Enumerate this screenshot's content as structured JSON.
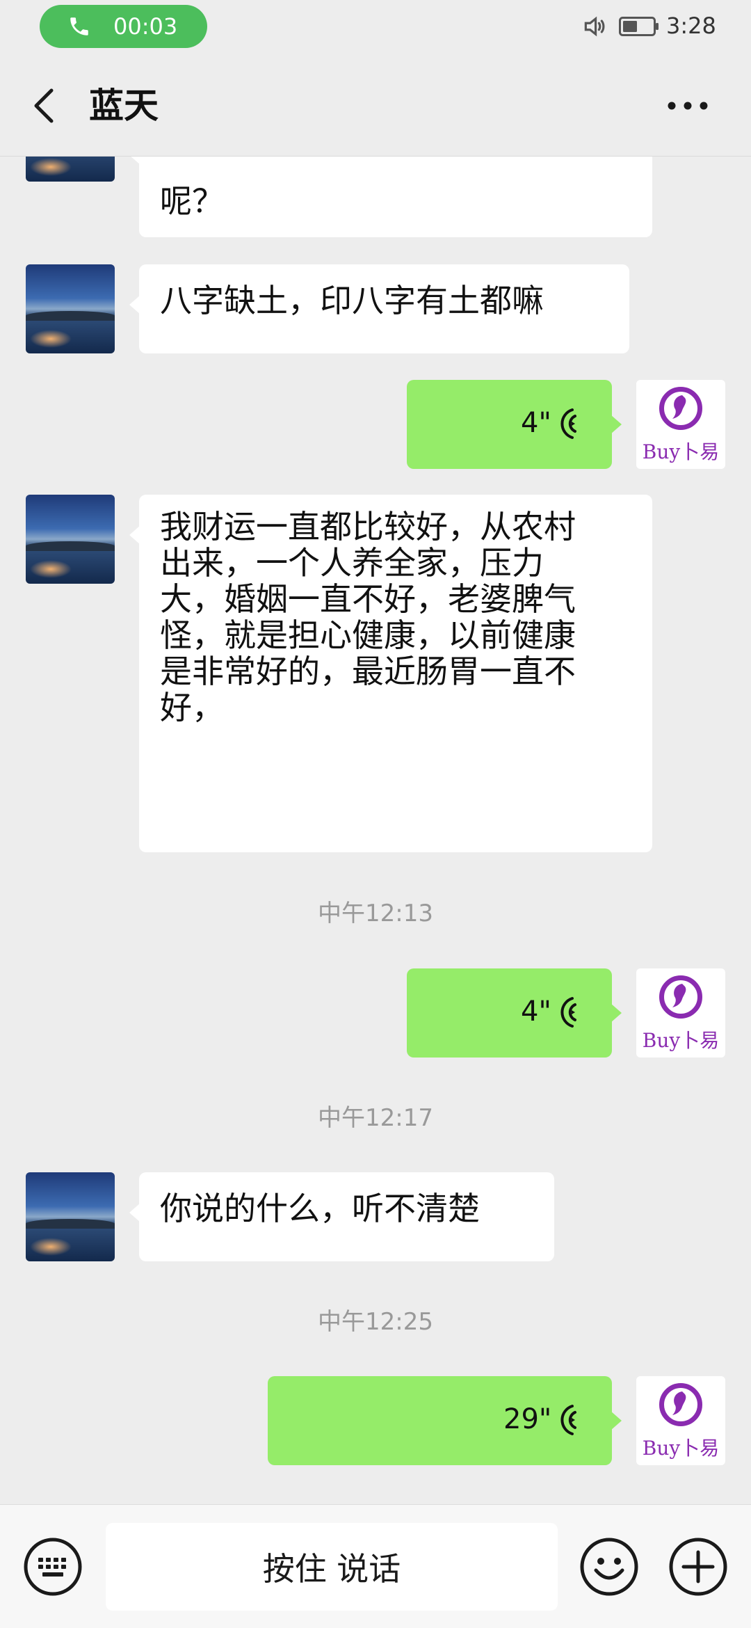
{
  "status_bar": {
    "call_duration": "00:03",
    "clock": "3:28"
  },
  "header": {
    "title": "蓝天"
  },
  "messages": [
    {
      "type": "text",
      "direction": "in",
      "text": "呢？"
    },
    {
      "type": "text",
      "direction": "in",
      "text": "八字缺土，印八字有土都嘛"
    },
    {
      "type": "voice",
      "direction": "out",
      "duration": "4\""
    },
    {
      "type": "text",
      "direction": "in",
      "text": "我财运一直都比较好，从农村出来，一个人养全家，压力大，婚姻一直不好，老婆脾气怪，就是担心健康，以前健康是非常好的，最近肠胃一直不好，"
    },
    {
      "type": "time",
      "text": "中午12:13"
    },
    {
      "type": "voice",
      "direction": "out",
      "duration": "4\""
    },
    {
      "type": "time",
      "text": "中午12:17"
    },
    {
      "type": "text",
      "direction": "in",
      "text": "你说的什么，听不清楚"
    },
    {
      "type": "time",
      "text": "中午12:25"
    },
    {
      "type": "voice",
      "direction": "out",
      "duration": "29\""
    }
  ],
  "message_lines": {
    "m3": [
      "我财运一直都比较好，从农村",
      "出来，一个人养全家，压力",
      "大，婚姻一直不好，老婆脾气",
      "怪，就是担心健康，以前健康",
      "是非常好的，最近肠胃一直不",
      "好，"
    ]
  },
  "self_avatar": {
    "brand": "Buy卜易"
  },
  "input_bar": {
    "hold_to_talk_label": "按住 说话"
  },
  "colors": {
    "background": "#ededed",
    "outgoing_bubble": "#95ec69",
    "incoming_bubble": "#ffffff",
    "call_pill": "#4cbe5c",
    "brand_purple": "#8a2bb0"
  },
  "icons": {
    "call": "phone-icon",
    "speaker": "speaker-icon",
    "battery": "battery-icon",
    "back": "chevron-left-icon",
    "more": "more-dots-icon",
    "voice": "voice-wave-icon",
    "keyboard": "keyboard-icon",
    "emoji": "emoji-icon",
    "plus": "plus-icon"
  }
}
